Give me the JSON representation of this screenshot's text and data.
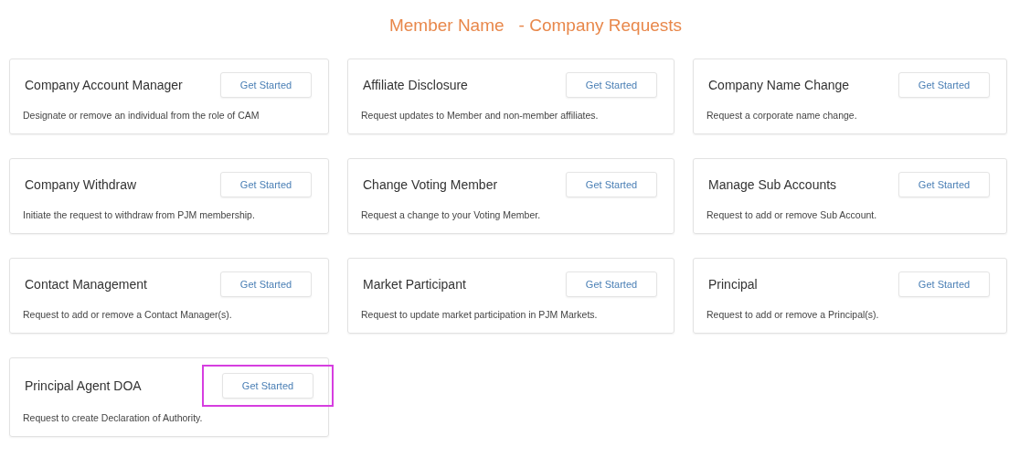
{
  "header": {
    "member_name": "Member Name",
    "title": "- Company Requests"
  },
  "requests": [
    {
      "title": "Company Account Manager",
      "button": "Get Started",
      "description": "Designate or remove an individual from the role of CAM",
      "highlighted": false
    },
    {
      "title": "Affiliate Disclosure",
      "button": "Get Started",
      "description": "Request updates to Member and non-member affiliates.",
      "highlighted": false
    },
    {
      "title": "Company Name Change",
      "button": "Get Started",
      "description": "Request a corporate name change.",
      "highlighted": false
    },
    {
      "title": "Company Withdraw",
      "button": "Get Started",
      "description": "Initiate the request to withdraw from PJM membership.",
      "highlighted": false
    },
    {
      "title": "Change Voting Member",
      "button": "Get Started",
      "description": "Request a change to your Voting Member.",
      "highlighted": false
    },
    {
      "title": "Manage Sub Accounts",
      "button": "Get Started",
      "description": "Request to add or remove Sub Account.",
      "highlighted": false
    },
    {
      "title": "Contact Management",
      "button": "Get Started",
      "description": "Request to add or remove a Contact Manager(s).",
      "highlighted": false
    },
    {
      "title": "Market Participant",
      "button": "Get Started",
      "description": "Request to update market participation in PJM Markets.",
      "highlighted": false
    },
    {
      "title": "Principal",
      "button": "Get Started",
      "description": "Request to add or remove a Principal(s).",
      "highlighted": false
    },
    {
      "title": "Principal Agent DOA",
      "button": "Get Started",
      "description": "Request to create Declaration of Authority.",
      "highlighted": true
    }
  ]
}
